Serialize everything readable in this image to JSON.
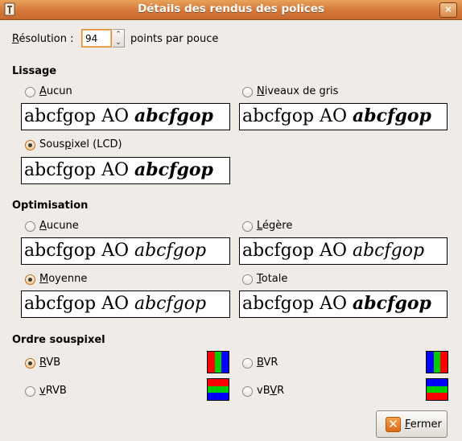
{
  "window": {
    "title": "Détails des rendus des polices",
    "close_glyph": "✕"
  },
  "resolution": {
    "label_prefix": "R",
    "label_rest": "ésolution :",
    "value": "94",
    "unit": "points par pouce"
  },
  "lissage": {
    "heading": "Lissage",
    "options": [
      {
        "key": "none",
        "label_u": "A",
        "label_rest": "ucun",
        "checked": false
      },
      {
        "key": "gray",
        "label_u": "N",
        "label_rest": "iveaux de gris",
        "checked": false
      },
      {
        "key": "subpixel",
        "label_pre": "Sous",
        "label_u": "p",
        "label_rest": "ixel (LCD)",
        "checked": true
      }
    ]
  },
  "optimisation": {
    "heading": "Optimisation",
    "options": [
      {
        "key": "none",
        "label_u": "A",
        "label_rest": "ucune",
        "checked": false
      },
      {
        "key": "slight",
        "label_u": "L",
        "label_rest": "égère",
        "checked": false
      },
      {
        "key": "medium",
        "label_u": "M",
        "label_rest": "oyenne",
        "checked": true
      },
      {
        "key": "full",
        "label_u": "T",
        "label_rest": "otale",
        "checked": false
      }
    ]
  },
  "subpixel_order": {
    "heading": "Ordre souspixel",
    "options": [
      {
        "key": "rgb",
        "label_u": "R",
        "label_rest": "VB",
        "checked": true,
        "colors": [
          "#ff0000",
          "#00cc00",
          "#0000ff"
        ]
      },
      {
        "key": "bgr",
        "label_u": "B",
        "label_rest": "VR",
        "checked": false,
        "colors": [
          "#0000ff",
          "#00cc00",
          "#ff0000"
        ]
      },
      {
        "key": "vrgb",
        "label_u": "v",
        "label_rest": "RVB",
        "checked": false,
        "colors": [
          "#ff0000",
          "#00cc00",
          "#0000ff"
        ]
      },
      {
        "key": "vbgr",
        "label_pre": "vB",
        "label_u": "V",
        "label_rest": "R",
        "checked": false,
        "colors": [
          "#0000ff",
          "#00cc00",
          "#ff0000"
        ]
      }
    ]
  },
  "preview": {
    "regular": "abcfgop AO ",
    "styled": "abcfgop"
  },
  "buttons": {
    "close_u": "F",
    "close_rest": "ermer",
    "close_icon": "close-icon"
  },
  "colors": {
    "titlebar": "#d4773a",
    "accent": "#e08a2f"
  }
}
